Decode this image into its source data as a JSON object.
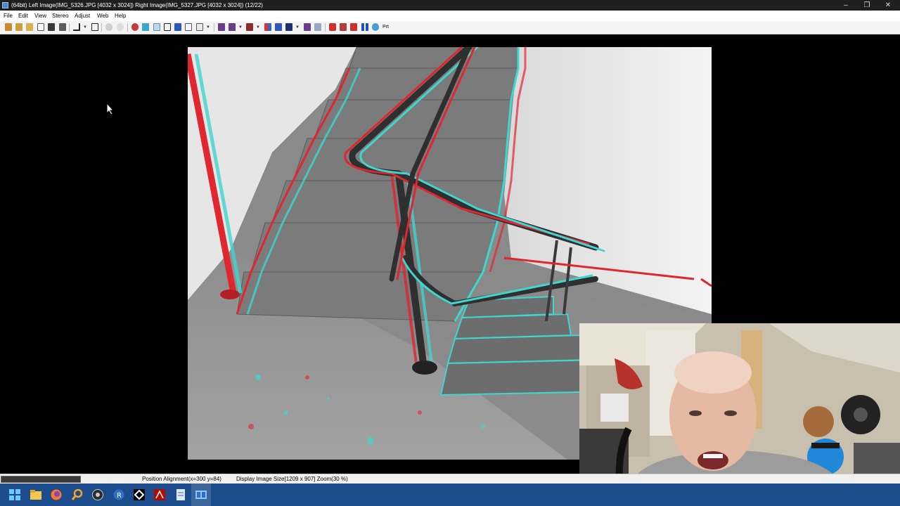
{
  "window": {
    "title": "(64bit) Left Image(IMG_5326.JPG [4032 x 3024]) Right Image(IMG_5327.JPG [4032 x 3024])  (12/22)",
    "minimize": "–",
    "maximize": "❐",
    "close": "✕"
  },
  "menu": {
    "items": [
      "File",
      "Edit",
      "View",
      "Stereo",
      "Adjust",
      "Web",
      "Help"
    ]
  },
  "toolbar": {
    "print_label": "Prt"
  },
  "status": {
    "alignment": "Position Alignment(x=300 y=84)",
    "display": "Display Image Size[1209 x 907]  Zoom(30 %)"
  },
  "colors": {
    "titlebar": "#1f1f1f",
    "taskbar": "#1c4c8c",
    "anaglyph_red": "#e0262f",
    "anaglyph_cyan": "#3fd6cf"
  },
  "taskbar": {
    "icons": [
      "windows-start-icon",
      "file-explorer-icon",
      "firefox-icon",
      "search-magnifier-icon",
      "obs-icon",
      "app-r-icon",
      "unity-icon",
      "acrobat-icon",
      "notepad-icon",
      "stereophoto-maker-icon"
    ]
  }
}
